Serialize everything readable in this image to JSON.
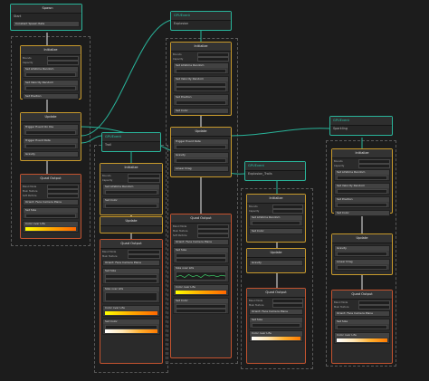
{
  "canvas": {
    "background": "#1c1c1c"
  },
  "colors": {
    "context_border": "#c89a2c",
    "output_border": "#c4532f",
    "event_border": "#29b49a",
    "flow_wire": "#29b49a",
    "spawn_wire": "#c8c8c8"
  },
  "spawner": {
    "title": "Spawn",
    "sub": "Start",
    "row": "Constant Spawn Rate"
  },
  "nodes": {
    "initialize": "Initialize",
    "update": "Update",
    "output": "Quad Output",
    "output2": "Output Particle Quad",
    "gpu_event": "GPUEvent"
  },
  "events": {
    "trail": "Trail",
    "explosion": "Explosion",
    "explosion_trails": "Explosion_Trails",
    "sparkling": "Sparkling"
  },
  "rows": {
    "set_lifetime": "Set Lifetime Random",
    "set_velocity": "Set Velocity Random",
    "set_position": "Set Position",
    "set_color": "Set Color",
    "trigger_die": "Trigger Event On Die",
    "trigger_rate": "Trigger Event Rate",
    "gravity": "Gravity",
    "linear_drag": "Linear Drag",
    "color_over_life": "Color over Life",
    "size_over_life": "Size over Life",
    "orient": "Orient: Face Camera Plane",
    "set_size": "Set Size",
    "main_texture": "Main Texture",
    "blend_mode": "Blend Mode",
    "soft_particle": "Soft Particle"
  }
}
